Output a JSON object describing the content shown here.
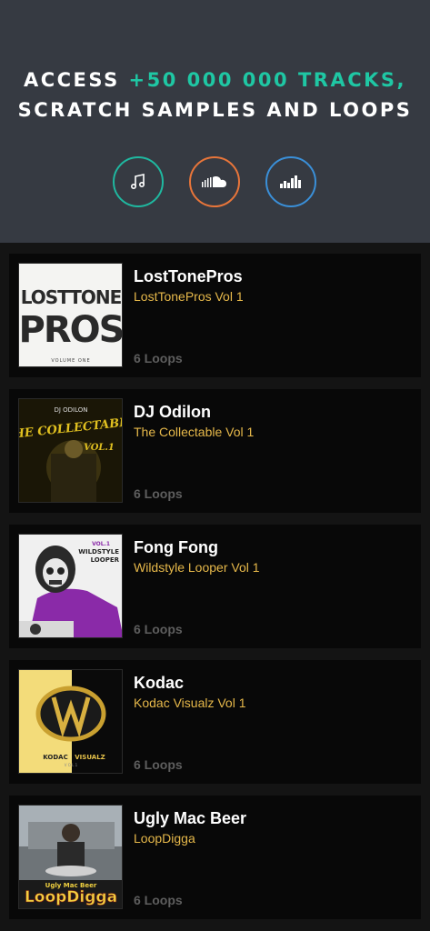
{
  "header": {
    "line1_prefix": "ACCESS ",
    "line1_accent": "+50 000 000 TRACKS,",
    "line2": "SCRATCH SAMPLES AND LOOPS",
    "accent_color": "#1fc7a4",
    "sources": [
      {
        "icon": "music-note-icon",
        "color": "#1fb8a0"
      },
      {
        "icon": "soundcloud-icon",
        "color": "#e8753a"
      },
      {
        "icon": "deezer-bars-icon",
        "color": "#3a8fd8"
      }
    ]
  },
  "packs": [
    {
      "artist": "LostTonePros",
      "title": "LostTonePros Vol 1",
      "loops": "6 Loops",
      "cover": {
        "line1": "LOSTTONE",
        "line2": "PROS",
        "line3": "VOLUME ONE"
      }
    },
    {
      "artist": "DJ Odilon",
      "title": "The Collectable Vol 1",
      "loops": "6 Loops",
      "cover": {
        "line1": "DJ ODILON",
        "line2": "THE COLLECTABLE",
        "line3": "VOL.1"
      }
    },
    {
      "artist": "Fong Fong",
      "title": "Wildstyle Looper Vol 1",
      "loops": "6 Loops",
      "cover": {
        "line1": "VOL.1",
        "line2": "WILDSTYLE",
        "line3": "LOOPER"
      }
    },
    {
      "artist": "Kodac",
      "title": "Kodac Visualz Vol 1",
      "loops": "6 Loops",
      "cover": {
        "line1": "KODAC",
        "line2": "VISUALZ",
        "line3": "V O L 1"
      }
    },
    {
      "artist": "Ugly Mac Beer",
      "title": "LoopDigga",
      "loops": "6 Loops",
      "cover": {
        "line1": "Ugly Mac Beer",
        "line2": "LoopDigga"
      }
    }
  ]
}
